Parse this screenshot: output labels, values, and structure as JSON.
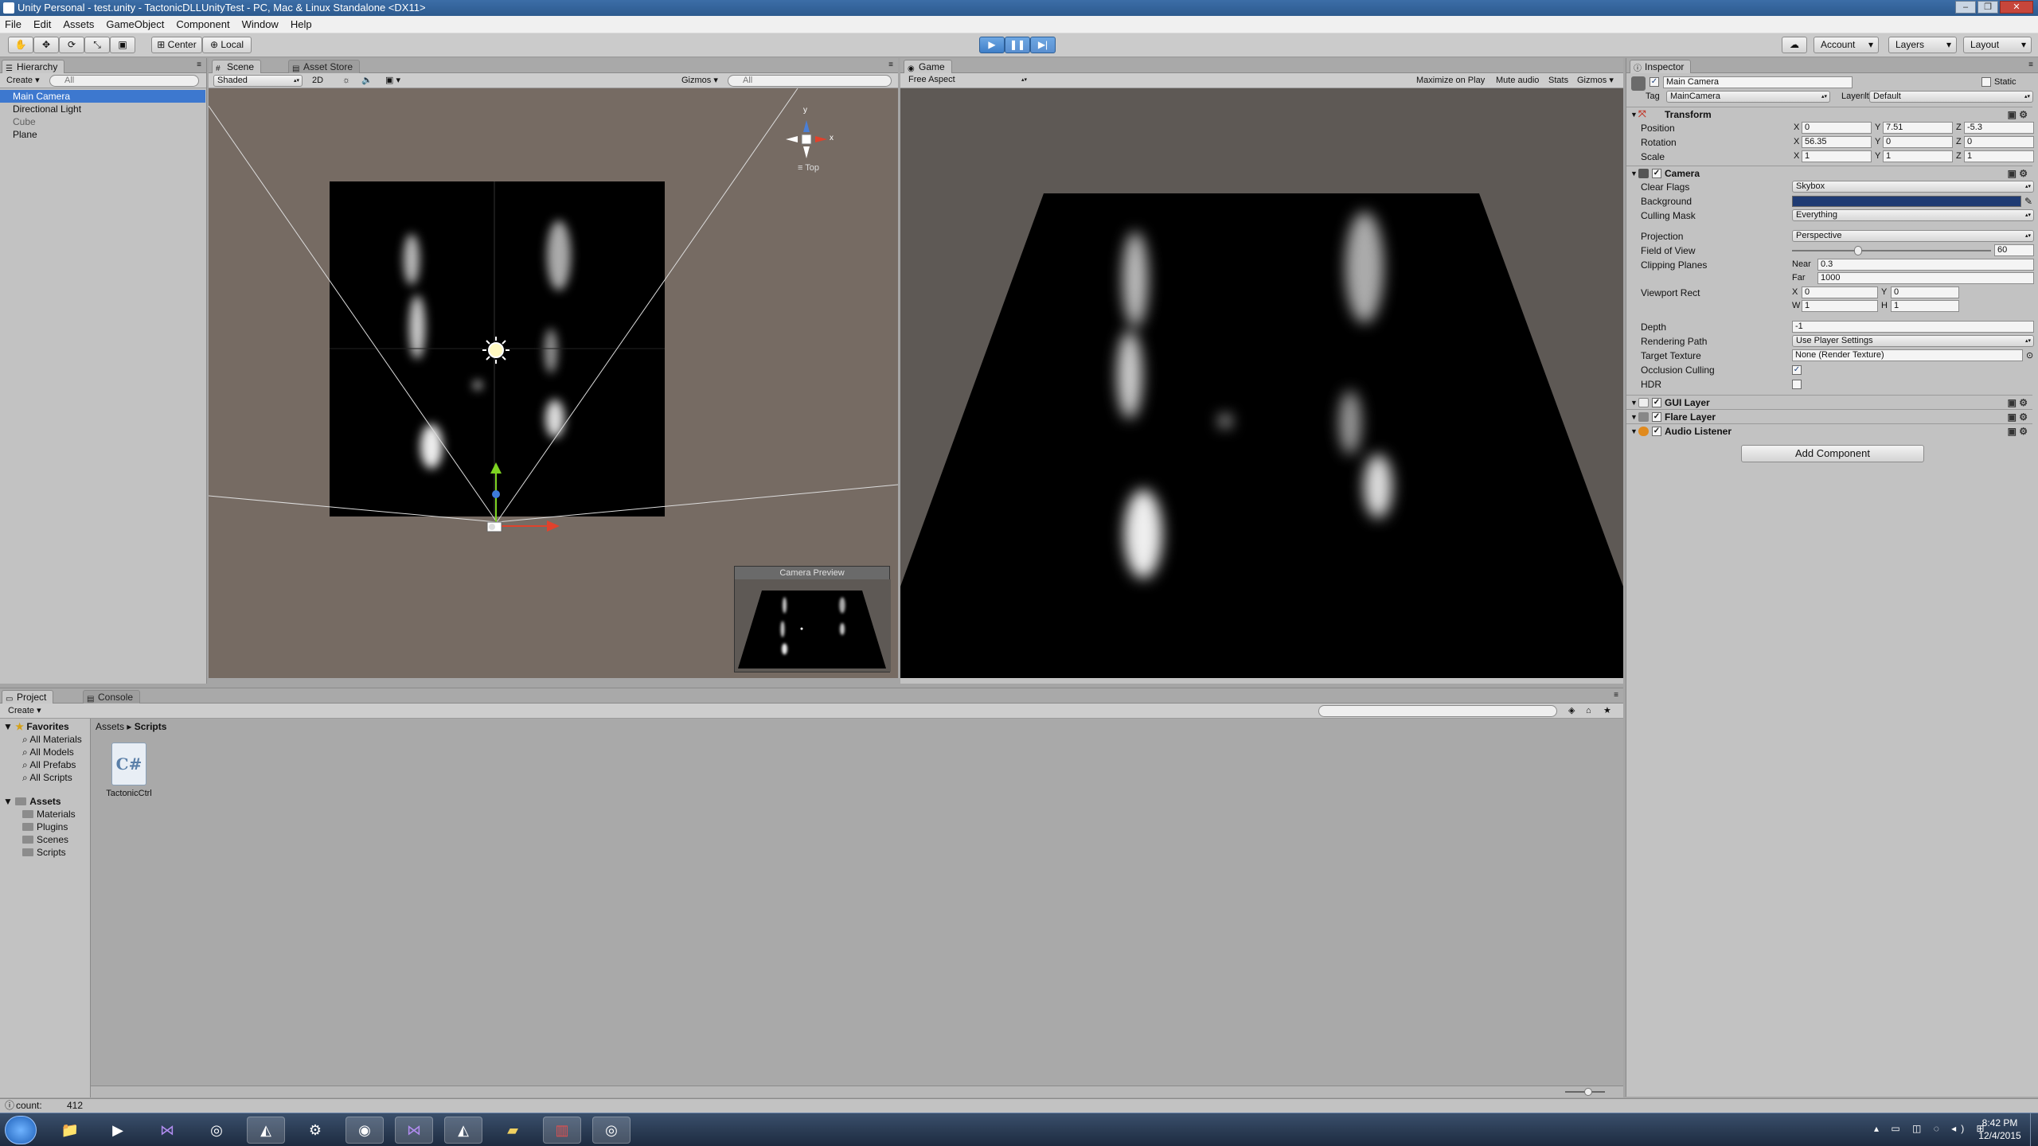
{
  "window": {
    "title": "Unity Personal - test.unity - TactonicDLLUnityTest - PC, Mac & Linux Standalone <DX11>",
    "controls": [
      "–",
      "❐",
      "✕"
    ]
  },
  "menu": [
    "File",
    "Edit",
    "Assets",
    "GameObject",
    "Component",
    "Window",
    "Help"
  ],
  "toolbar": {
    "pivot_label": "Center",
    "space_label": "Local",
    "account_label": "Account",
    "layers_label": "Layers",
    "layout_label": "Layout",
    "play_active": true
  },
  "hierarchy": {
    "tab": "Hierarchy",
    "create_label": "Create",
    "search_placeholder": "All",
    "items": [
      {
        "label": "Main Camera",
        "state": "selected"
      },
      {
        "label": "Directional Light",
        "state": "normal"
      },
      {
        "label": "Cube",
        "state": "disabled"
      },
      {
        "label": "Plane",
        "state": "normal"
      }
    ]
  },
  "scene": {
    "tabs": [
      "Scene",
      "Asset Store"
    ],
    "shading": "Shaded",
    "mode_2d": "2D",
    "gizmos_label": "Gizmos",
    "search_placeholder": "All",
    "view_label": "Top",
    "gizmo_axes": {
      "y": "y",
      "x": "x"
    },
    "camera_preview_label": "Camera Preview"
  },
  "game": {
    "tab": "Game",
    "aspect": "Free Aspect",
    "options": [
      "Maximize on Play",
      "Mute audio",
      "Stats",
      "Gizmos"
    ]
  },
  "inspector": {
    "tab": "Inspector",
    "object_name": "Main Camera",
    "static_label": "Static",
    "tag_label": "Tag",
    "tag_value": "MainCamera",
    "layer_label": "Layer",
    "layer_value": "Default",
    "transform": {
      "title": "Transform",
      "position_label": "Position",
      "position": {
        "x": "0",
        "y": "7.51",
        "z": "-5.3"
      },
      "rotation_label": "Rotation",
      "rotation": {
        "x": "56.35",
        "y": "0",
        "z": "0"
      },
      "scale_label": "Scale",
      "scale": {
        "x": "1",
        "y": "1",
        "z": "1"
      }
    },
    "camera": {
      "title": "Camera",
      "clear_flags_label": "Clear Flags",
      "clear_flags": "Skybox",
      "background_label": "Background",
      "background_color": "#1f3b73",
      "culling_mask_label": "Culling Mask",
      "culling_mask": "Everything",
      "projection_label": "Projection",
      "projection": "Perspective",
      "fov_label": "Field of View",
      "fov": "60",
      "fov_fraction": 0.33,
      "clipping_label": "Clipping Planes",
      "near_label": "Near",
      "near": "0.3",
      "far_label": "Far",
      "far": "1000",
      "viewport_label": "Viewport Rect",
      "viewport": {
        "x": "0",
        "y": "0",
        "w": "1",
        "h": "1"
      },
      "depth_label": "Depth",
      "depth": "-1",
      "rendering_path_label": "Rendering Path",
      "rendering_path": "Use Player Settings",
      "target_texture_label": "Target Texture",
      "target_texture": "None (Render Texture)",
      "occlusion_label": "Occlusion Culling",
      "occlusion": true,
      "hdr_label": "HDR",
      "hdr": false
    },
    "components": [
      "GUI Layer",
      "Flare Layer",
      "Audio Listener"
    ],
    "add_component_label": "Add Component"
  },
  "project": {
    "tabs": [
      "Project",
      "Console"
    ],
    "create_label": "Create",
    "favorites_label": "Favorites",
    "favorites": [
      "All Materials",
      "All Models",
      "All Prefabs",
      "All Scripts"
    ],
    "assets_label": "Assets",
    "asset_folders": [
      "Materials",
      "Plugins",
      "Scenes",
      "Scripts"
    ],
    "breadcrumb": [
      "Assets",
      "Scripts"
    ],
    "files": [
      {
        "name": "TactonicCtrl",
        "type": "C#"
      }
    ]
  },
  "status": {
    "text": "count:",
    "value": "412"
  },
  "taskbar": {
    "time": "8:42 PM",
    "date": "12/4/2015"
  },
  "colors": {
    "selection": "#3d78cf",
    "play_button": "#4a8ad4",
    "scene_bg": "#766b63",
    "game_bg": "#5e5955"
  }
}
